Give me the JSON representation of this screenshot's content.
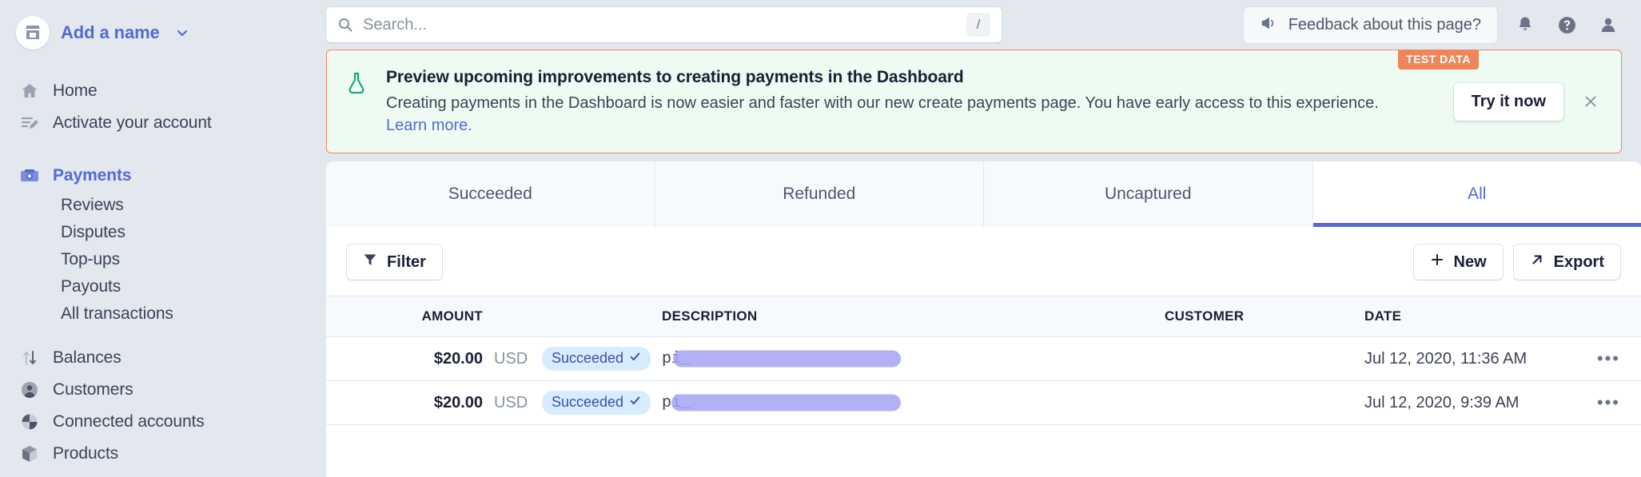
{
  "sidebar": {
    "account": {
      "name": "Add a name",
      "avatar_icon": "store-icon",
      "caret_icon": "chevron-down-icon"
    },
    "items": [
      {
        "label": "Home",
        "icon": "home-icon",
        "active": false
      },
      {
        "label": "Activate your account",
        "icon": "edit-list-icon",
        "active": false
      },
      {
        "label": "Payments",
        "icon": "payments-icon",
        "active": true
      },
      {
        "label": "Balances",
        "icon": "balances-icon",
        "active": false
      },
      {
        "label": "Customers",
        "icon": "customers-icon",
        "active": false
      },
      {
        "label": "Connected accounts",
        "icon": "connected-accounts-icon",
        "active": false
      },
      {
        "label": "Products",
        "icon": "products-icon",
        "active": false
      }
    ],
    "sub_items": [
      {
        "label": "Reviews"
      },
      {
        "label": "Disputes"
      },
      {
        "label": "Top-ups"
      },
      {
        "label": "Payouts"
      },
      {
        "label": "All transactions"
      }
    ]
  },
  "topbar": {
    "search": {
      "placeholder": "Search...",
      "value": "",
      "icon": "search-icon",
      "shortcut": "/"
    },
    "feedback": {
      "label": "Feedback about this page?",
      "icon": "megaphone-icon"
    },
    "notifications_icon": "bell-icon",
    "help_icon": "question-circle-icon",
    "account_icon": "user-avatar-icon"
  },
  "banner": {
    "badge": "TEST DATA",
    "icon": "flask-icon",
    "title": "Preview upcoming improvements to creating payments in the Dashboard",
    "description": "Creating payments in the Dashboard is now easier and faster with our new create payments page. You have early access to this experience.",
    "link": "Learn more.",
    "action_label": "Try it now",
    "close_icon": "close-icon"
  },
  "tabs": [
    {
      "label": "Succeeded",
      "active": false
    },
    {
      "label": "Refunded",
      "active": false
    },
    {
      "label": "Uncaptured",
      "active": false
    },
    {
      "label": "All",
      "active": true
    }
  ],
  "toolbar": {
    "filter_label": "Filter",
    "filter_icon": "funnel-icon",
    "new_label": "New",
    "new_icon": "plus-icon",
    "export_label": "Export",
    "export_icon": "arrow-up-right-icon"
  },
  "table": {
    "columns": {
      "amount": "AMOUNT",
      "description": "DESCRIPTION",
      "customer": "CUSTOMER",
      "date": "DATE"
    },
    "rows": [
      {
        "amount": "$20.00",
        "currency": "USD",
        "status": "Succeeded",
        "status_icon": "check-icon",
        "description_prefix": "pi_",
        "description_redacted": true,
        "customer": "",
        "date": "Jul 12, 2020, 11:36 AM",
        "menu_icon": "overflow-menu-icon",
        "menu_label": "•••"
      },
      {
        "amount": "$20.00",
        "currency": "USD",
        "status": "Succeeded",
        "status_icon": "check-icon",
        "description_prefix": "pi_",
        "description_redacted": true,
        "customer": "",
        "date": "Jul 12, 2020, 9:39 AM",
        "menu_icon": "overflow-menu-icon",
        "menu_label": "•••"
      }
    ]
  },
  "colors": {
    "brand": "#5469d4",
    "sidebar_bg": "#e3e8ee",
    "banner_bg": "#eefbf2",
    "banner_border": "#f0855a",
    "badge_bg": "#f0855a",
    "status_bg": "#d6ecff",
    "status_text": "#3d4eac",
    "flask_green": "#24a47f",
    "redaction": "#a5a2f5"
  }
}
